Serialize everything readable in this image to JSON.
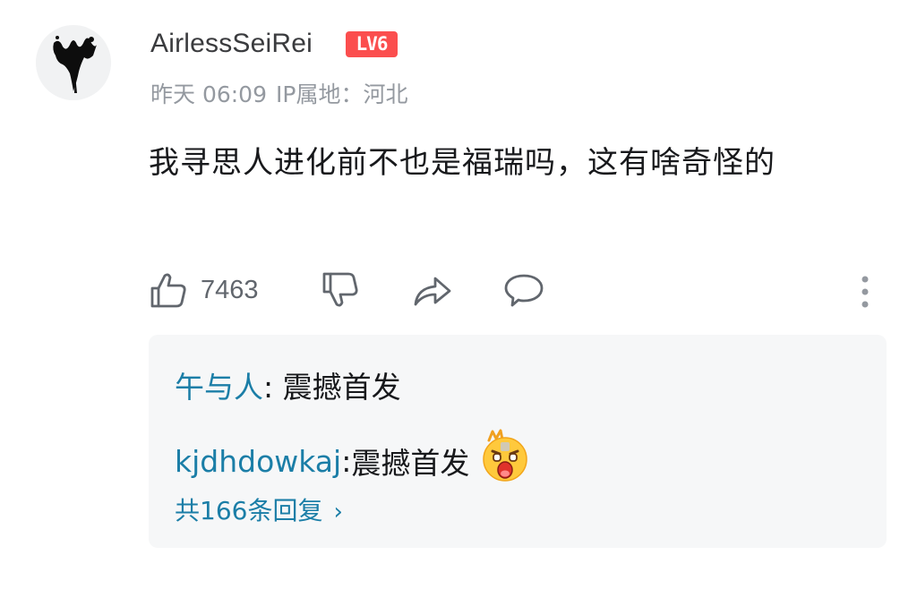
{
  "comment": {
    "username": "AirlessSeiRei",
    "level_badge": "LV6",
    "time": "昨天 06:09",
    "ip_location": "IP属地：河北",
    "text": "我寻思人进化前不也是福瑞吗，这有啥奇怪的",
    "like_count": "7463"
  },
  "actions": {
    "icons": [
      "thumbs-up-icon",
      "thumbs-down-icon",
      "share-icon",
      "comment-icon",
      "more-icon"
    ]
  },
  "replies": [
    {
      "author": "午与人",
      "separator": ": ",
      "text": "震撼首发"
    },
    {
      "author": "kjdhdowkaj",
      "separator": ": ",
      "text": "震撼首发",
      "emoji": "shocked-emoji"
    }
  ],
  "reply_count_label": "共166条回复",
  "colors": {
    "accent_blue": "#1b7ea7",
    "badge_red": "#fb4e4e",
    "meta_gray": "#9499a0",
    "reply_bg": "#f6f7f8"
  }
}
